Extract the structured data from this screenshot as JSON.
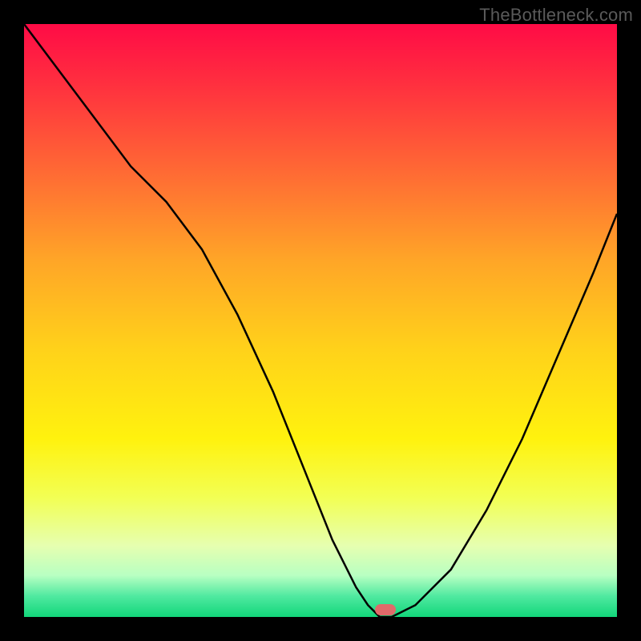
{
  "watermark": "TheBottleneck.com",
  "chart_data": {
    "type": "line",
    "title": "",
    "xlabel": "",
    "ylabel": "",
    "xlim": [
      0,
      100
    ],
    "ylim": [
      0,
      100
    ],
    "x": [
      0,
      6,
      12,
      18,
      24,
      30,
      36,
      42,
      48,
      52,
      56,
      58,
      60,
      62,
      66,
      72,
      78,
      84,
      90,
      96,
      100
    ],
    "values": [
      100,
      92,
      84,
      76,
      70,
      62,
      51,
      38,
      23,
      13,
      5,
      2,
      0,
      0,
      2,
      8,
      18,
      30,
      44,
      58,
      68
    ],
    "gradient_stops": [
      {
        "pos": 0.0,
        "color": "#ff0b46"
      },
      {
        "pos": 0.1,
        "color": "#ff2f3f"
      },
      {
        "pos": 0.25,
        "color": "#ff6a34"
      },
      {
        "pos": 0.4,
        "color": "#ffa627"
      },
      {
        "pos": 0.55,
        "color": "#ffd21a"
      },
      {
        "pos": 0.7,
        "color": "#fff20e"
      },
      {
        "pos": 0.8,
        "color": "#f2ff55"
      },
      {
        "pos": 0.88,
        "color": "#e6ffb0"
      },
      {
        "pos": 0.93,
        "color": "#b8ffc2"
      },
      {
        "pos": 0.965,
        "color": "#4fe9a0"
      },
      {
        "pos": 1.0,
        "color": "#12d67a"
      }
    ],
    "curve_color": "#000000",
    "curve_width": 2.5,
    "marker": {
      "x": 61,
      "y": 1.2,
      "color": "#e06a6a"
    }
  }
}
